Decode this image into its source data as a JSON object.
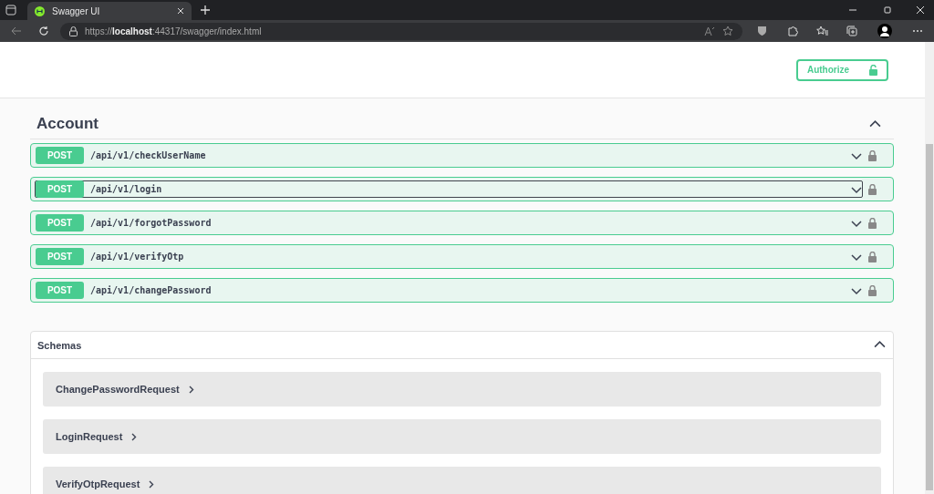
{
  "browser": {
    "tab": {
      "title": "Swagger UI",
      "selected": true
    },
    "url": {
      "scheme": "https://",
      "host": "localhost",
      "rest": ":44317/swagger/index.html"
    }
  },
  "authorize": {
    "label": "Authorize"
  },
  "section": {
    "title": "Account",
    "expanded": true,
    "operations": [
      {
        "method": "POST",
        "path": "/api/v1/checkUserName",
        "focused": false
      },
      {
        "method": "POST",
        "path": "/api/v1/login",
        "focused": true
      },
      {
        "method": "POST",
        "path": "/api/v1/forgotPassword",
        "focused": false
      },
      {
        "method": "POST",
        "path": "/api/v1/verifyOtp",
        "focused": false
      },
      {
        "method": "POST",
        "path": "/api/v1/changePassword",
        "focused": false
      }
    ]
  },
  "schemas": {
    "title": "Schemas",
    "expanded": true,
    "models": [
      "ChangePasswordRequest",
      "LoginRequest",
      "VerifyOtpRequest"
    ]
  }
}
